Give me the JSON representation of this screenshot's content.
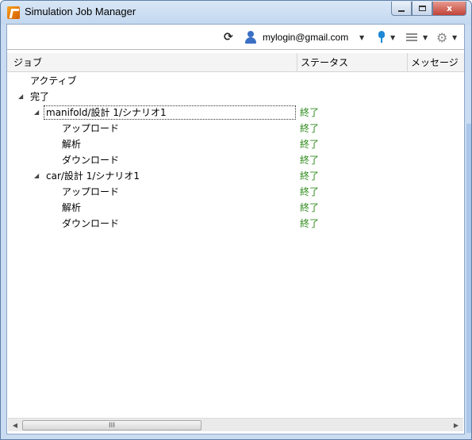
{
  "window": {
    "title": "Simulation Job Manager",
    "minimize_icon": "minimize-icon",
    "maximize_icon": "maximize-icon",
    "close_label": "x"
  },
  "toolbar": {
    "refresh_icon": "refresh-icon",
    "refresh_glyph": "⟳",
    "user_icon": "user-icon",
    "account": "mylogin@gmail.com",
    "filter_icon": "filter-icon",
    "list_icon": "list-icon",
    "gear_icon": "gear-icon",
    "gear_glyph": "⚙",
    "caret": "▼"
  },
  "grid": {
    "columns": {
      "job": "ジョブ",
      "status": "ステータス",
      "message": "メッセージ"
    },
    "rows": [
      {
        "level": 0,
        "label": "アクティブ",
        "expander": "",
        "status": ""
      },
      {
        "level": 0,
        "label": "完了",
        "expander": "◢",
        "status": ""
      },
      {
        "level": 1,
        "label": "manifold/設計 1/シナリオ1",
        "expander": "◢",
        "status": "終了"
      },
      {
        "level": 2,
        "label": "アップロード",
        "expander": "",
        "status": "終了"
      },
      {
        "level": 2,
        "label": "解析",
        "expander": "",
        "status": "終了"
      },
      {
        "level": 2,
        "label": "ダウンロード",
        "expander": "",
        "status": "終了"
      },
      {
        "level": 1,
        "label": "car/設計 1/シナリオ1",
        "expander": "◢",
        "status": "終了"
      },
      {
        "level": 2,
        "label": "アップロード",
        "expander": "",
        "status": "終了"
      },
      {
        "level": 2,
        "label": "解析",
        "expander": "",
        "status": "終了"
      },
      {
        "level": 2,
        "label": "ダウンロード",
        "expander": "",
        "status": "終了"
      }
    ],
    "status_color": "#2d8a1a"
  },
  "scrollbar": {
    "left_arrow": "◀",
    "right_arrow": "▶",
    "thumb_grip": "III"
  }
}
